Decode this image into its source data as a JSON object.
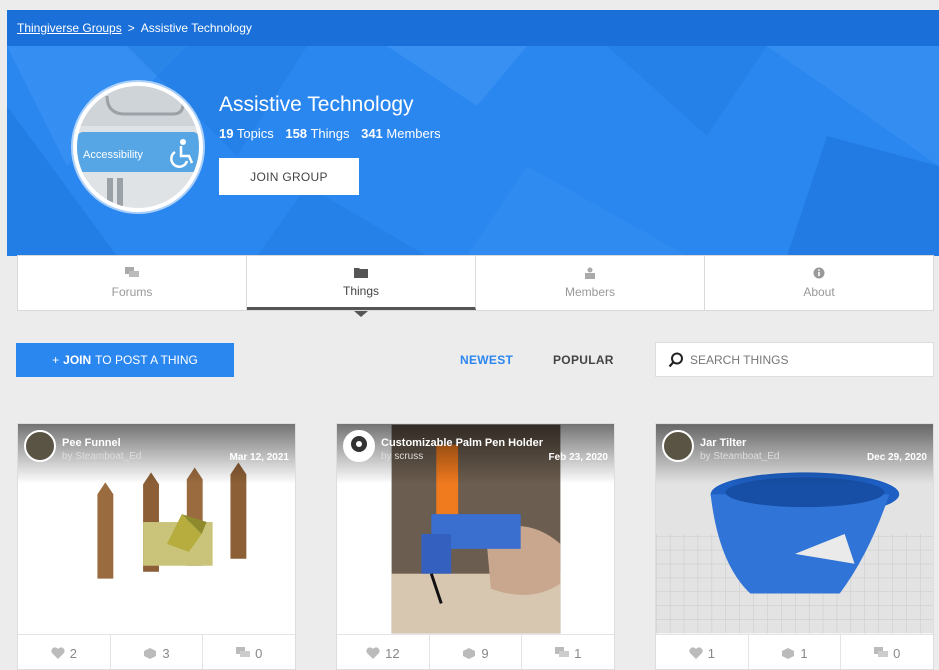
{
  "breadcrumb": {
    "root": "Thingiverse Groups",
    "separator": ">",
    "current": "Assistive Technology"
  },
  "group": {
    "name": "Assistive Technology",
    "avatar_text": "Accessibility",
    "stats": {
      "topics_count": "19",
      "topics_label": "Topics",
      "things_count": "158",
      "things_label": "Things",
      "members_count": "341",
      "members_label": "Members"
    },
    "join_label": "JOIN GROUP"
  },
  "tabs": [
    {
      "label": "Forums",
      "icon": "forums-icon",
      "active": false
    },
    {
      "label": "Things",
      "icon": "things-icon",
      "active": true
    },
    {
      "label": "Members",
      "icon": "members-icon",
      "active": false
    },
    {
      "label": "About",
      "icon": "about-icon",
      "active": false
    }
  ],
  "actions": {
    "post_prefix": "+",
    "post_bold": "JOIN",
    "post_rest": "TO POST A THING",
    "sort_newest": "NEWEST",
    "sort_popular": "POPULAR",
    "search_placeholder": "SEARCH THINGS"
  },
  "cards": [
    {
      "title": "Pee Funnel",
      "by": "by Steamboat_Ed",
      "date": "Mar 12, 2021",
      "likes": "2",
      "collects": "3",
      "comments": "0"
    },
    {
      "title": "Customizable Palm Pen Holder",
      "by": "by scruss",
      "date": "Feb 23, 2020",
      "likes": "12",
      "collects": "9",
      "comments": "1"
    },
    {
      "title": "Jar Tilter",
      "by": "by Steamboat_Ed",
      "date": "Dec 29, 2020",
      "likes": "1",
      "collects": "1",
      "comments": "0"
    }
  ],
  "colors": {
    "brand_blue": "#2b87f0",
    "crumb_blue": "#1a70d8"
  }
}
